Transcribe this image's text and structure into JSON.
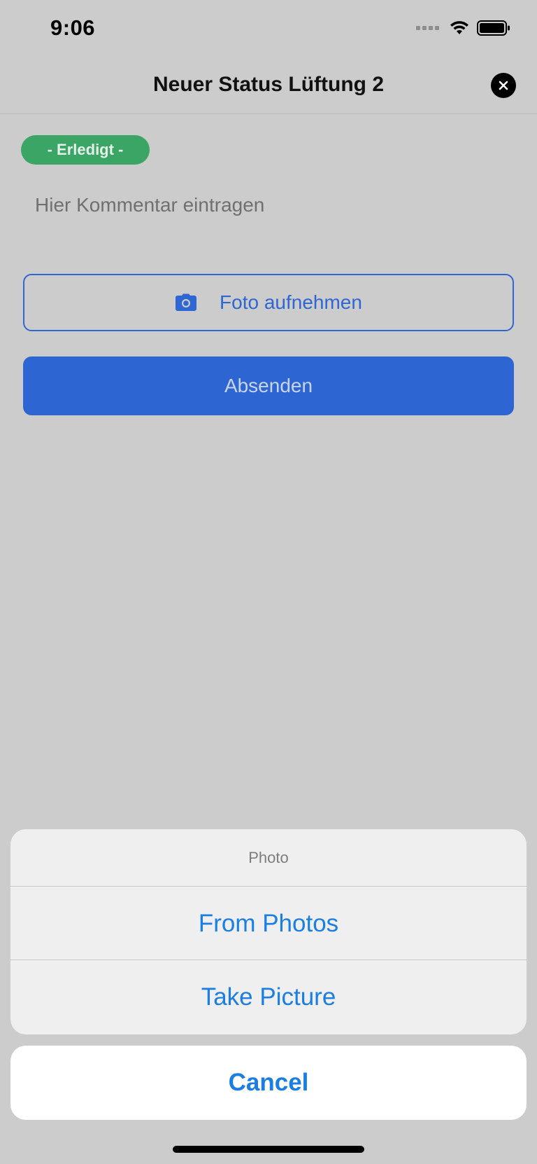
{
  "status_bar": {
    "time": "9:06",
    "icons": [
      "cellular-signal-icon",
      "wifi-icon",
      "battery-icon"
    ]
  },
  "header": {
    "title": "Neuer Status Lüftung 2",
    "close_icon": "close-icon"
  },
  "status_badge": {
    "label": "- Erledigt -",
    "color": "#3aa565"
  },
  "comment": {
    "placeholder": "Hier Kommentar eintragen",
    "value": ""
  },
  "photo_button": {
    "label": "Foto aufnehmen",
    "icon": "camera-icon"
  },
  "submit_button": {
    "label": "Absenden"
  },
  "action_sheet": {
    "title": "Photo",
    "items": [
      "From Photos",
      "Take Picture"
    ],
    "cancel_label": "Cancel"
  },
  "colors": {
    "accent": "#2d66d2",
    "ios_blue": "#1a7ee3",
    "background_dimmed": "#cccccc"
  }
}
